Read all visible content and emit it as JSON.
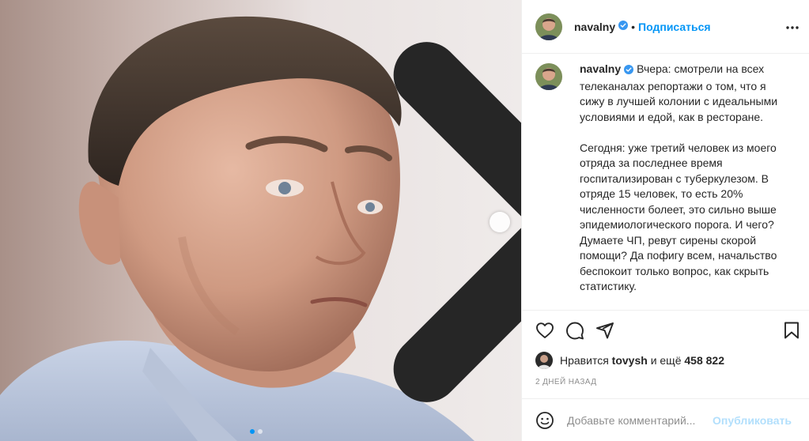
{
  "post": {
    "username": "navalny",
    "verified": true,
    "follow_label": "Подписаться",
    "separator": "•",
    "more_icon": "more-horizontal-icon"
  },
  "photo": {
    "next_icon": "chevron-right-icon",
    "slide_count": 2,
    "active_slide": 1
  },
  "caption": {
    "username": "navalny",
    "paragraphs": [
      "Вчера: смотрели на всех телеканалах репортажи о том, что я сижу в лучшей колонии с идеальными условиями и едой, как в ресторане.",
      "Сегодня: уже третий человек из моего отряда за последнее время госпитализирован с туберкулезом. В отряде 15 человек, то есть 20% численности болеет, это сильно выше эпидемиологического порога. И чего? Думаете ЧП, ревут сирены скорой помощи? Да пофигу всем, начальство беспокоит только вопрос, как скрыть статистику."
    ]
  },
  "actions": {
    "like_icon": "heart-icon",
    "comment_icon": "comment-icon",
    "share_icon": "paper-plane-icon",
    "save_icon": "bookmark-icon"
  },
  "likes": {
    "prefix": "Нравится",
    "user": "tovysh",
    "middle": "и ещё",
    "count": "458 822"
  },
  "timestamp": "2 дней назад",
  "comment": {
    "placeholder": "Добавьте комментарий...",
    "publish_label": "Опубликовать",
    "emoji_icon": "smiley-icon"
  },
  "colors": {
    "accent": "#0095f6",
    "publish_disabled": "#b2dffc",
    "muted": "#8e8e8e",
    "border": "#efefef"
  }
}
